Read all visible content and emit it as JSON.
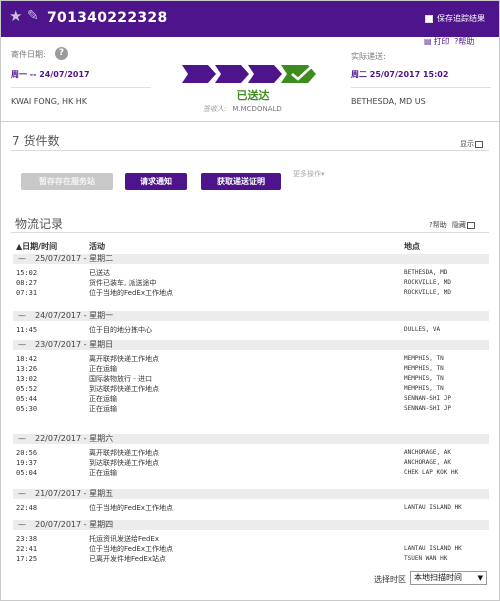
{
  "header": {
    "tracking_number": "701340222328",
    "save_label": "保存追踪结果",
    "print_label": "打印",
    "help_label": "帮助"
  },
  "shipment": {
    "ship_date_label": "寄件日期:",
    "ship_date": "周一 -- 24/07/2017",
    "origin": "KWAI FONG, HK HK",
    "delivery_label": "实际递送:",
    "delivery_date": "周二 25/07/2017 15:02",
    "destination": "BETHESDA, MD US",
    "status": "已送达",
    "signer_label": "签收人:",
    "signer_name": "M.MCDONALD"
  },
  "pieces": {
    "title": "7 货件数",
    "display_label": "显示",
    "hold_button": "暂存存在服务站",
    "notify_button": "请求通知",
    "proof_button": "获取递送证明",
    "more_actions": "更多操作▾"
  },
  "history": {
    "title": "物流记录",
    "help_label": "帮助",
    "collapse_label": "隐藏",
    "col_datetime": "▲日期/时间",
    "col_activity": "活动",
    "col_location": "地点",
    "groups": [
      {
        "date": "25/07/2017 - 星期二",
        "rows": [
          {
            "time": "15:02",
            "activity": "已送达",
            "location": "BETHESDA, MD"
          },
          {
            "time": "08:27",
            "activity": "货件已装车, 派送途中",
            "location": "ROCKVILLE, MD"
          },
          {
            "time": "07:31",
            "activity": "位于当地的FedEx工作地点",
            "location": "ROCKVILLE, MD"
          }
        ]
      },
      {
        "date": "24/07/2017 - 星期一",
        "rows": [
          {
            "time": "11:45",
            "activity": "位于目的地分拣中心",
            "location": "DULLES, VA"
          }
        ]
      },
      {
        "date": "23/07/2017 - 星期日",
        "rows": [
          {
            "time": "18:42",
            "activity": "离开联邦快递工作地点",
            "location": "MEMPHIS, TN"
          },
          {
            "time": "13:26",
            "activity": "正在运输",
            "location": "MEMPHIS, TN"
          },
          {
            "time": "13:02",
            "activity": "国际装物放行 - 进口",
            "location": "MEMPHIS, TN"
          },
          {
            "time": "05:52",
            "activity": "到达联邦快递工作地点",
            "location": "MEMPHIS, TN"
          },
          {
            "time": "05:44",
            "activity": "正在运输",
            "location": "SENNAN-SHI JP"
          },
          {
            "time": "05:30",
            "activity": "正在运输",
            "location": "SENNAN-SHI JP"
          }
        ]
      },
      {
        "date": "22/07/2017 - 星期六",
        "rows": [
          {
            "time": "20:56",
            "activity": "离开联邦快递工作地点",
            "location": "ANCHORAGE, AK"
          },
          {
            "time": "19:37",
            "activity": "到达联邦快递工作地点",
            "location": "ANCHORAGE, AK"
          },
          {
            "time": "05:04",
            "activity": "正在运输",
            "location": "CHEK LAP KOK HK"
          }
        ]
      },
      {
        "date": "21/07/2017 - 星期五",
        "rows": [
          {
            "time": "22:48",
            "activity": "位于当地的FedEx工作地点",
            "location": "LANTAU ISLAND HK"
          }
        ]
      },
      {
        "date": "20/07/2017 - 星期四",
        "rows": [
          {
            "time": "23:38",
            "activity": "托运资讯发送给FedEx",
            "location": ""
          },
          {
            "time": "22:41",
            "activity": "位于当地的FedEx工作地点",
            "location": "LANTAU ISLAND HK"
          },
          {
            "time": "17:25",
            "activity": "已离开发件地FedEx站点",
            "location": "TSUEN WAN HK"
          }
        ]
      }
    ]
  },
  "timezone": {
    "label": "选择时区",
    "selected": "本地扫描时间"
  },
  "colors": {
    "brand_purple": "#4d148c",
    "delivered_green": "#3c8c1e"
  }
}
